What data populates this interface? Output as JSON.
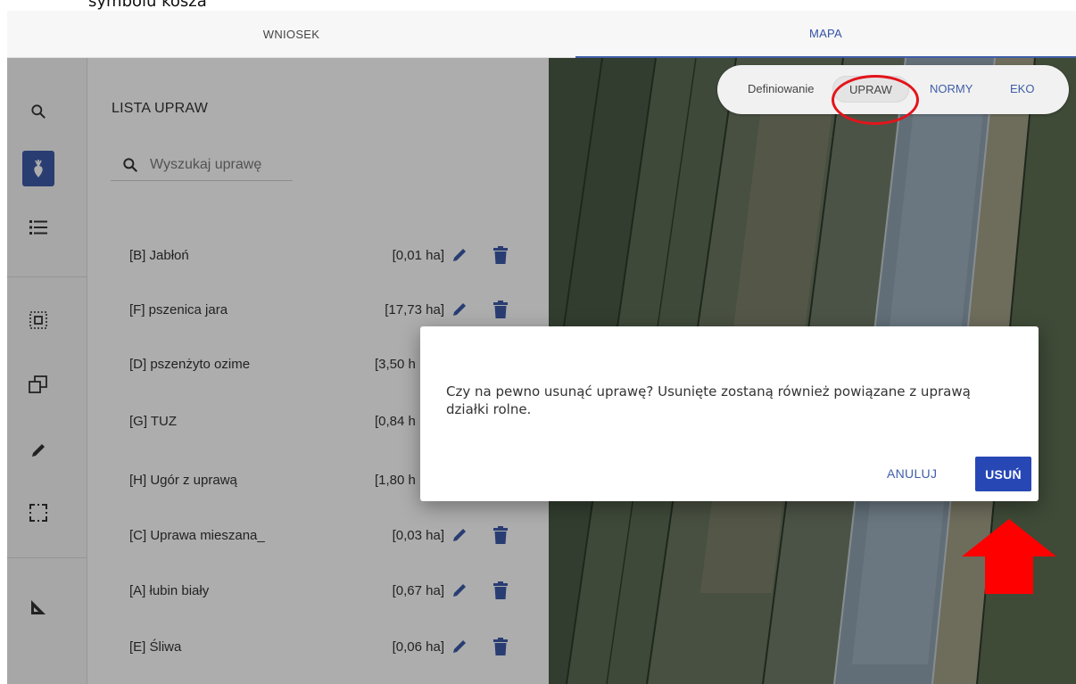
{
  "document": {
    "caption_partial": "symbolu kosza"
  },
  "tabs": {
    "wniosek": "WNIOSEK",
    "mapa": "MAPA"
  },
  "sidebar": {
    "icons": [
      "search-icon",
      "crop-icon",
      "list-icon",
      "select-area-icon",
      "copy-icon",
      "pencil-icon",
      "rectangle-select-icon",
      "ruler-icon"
    ],
    "active_index": 1,
    "accent": "#3d5ba9"
  },
  "panel": {
    "title": "LISTA UPRAW",
    "search_placeholder": "Wyszukaj uprawę",
    "crops": [
      {
        "name": "[B] Jabłoń",
        "area": "[0,01 ha]"
      },
      {
        "name": "[F] pszenica jara",
        "area": "[17,73 ha]"
      },
      {
        "name": "[D] pszenżyto ozime",
        "area": "[3,50 h"
      },
      {
        "name": "[G] TUZ",
        "area": "[0,84 h"
      },
      {
        "name": "[H] Ugór z uprawą",
        "area": "[1,80 h"
      },
      {
        "name": "[C] Uprawa mieszana_",
        "area": "[0,03 ha]"
      },
      {
        "name": "[A] łubin biały",
        "area": "[0,67 ha]"
      },
      {
        "name": "[E] Śliwa",
        "area": "[0,06 ha]"
      }
    ]
  },
  "map_toggle": {
    "label": "Definiowanie",
    "options": [
      "UPRAW",
      "NORMY",
      "EKO"
    ],
    "selected": "UPRAW"
  },
  "dialog": {
    "message": "Czy na pewno usunąć uprawę? Usunięte zostaną również powiązane z uprawą działki rolne.",
    "cancel": "ANULUJ",
    "confirm": "USUŃ"
  },
  "colors": {
    "primary": "#2747b5",
    "link": "#3f5ea8",
    "highlight": "#e3141b"
  }
}
